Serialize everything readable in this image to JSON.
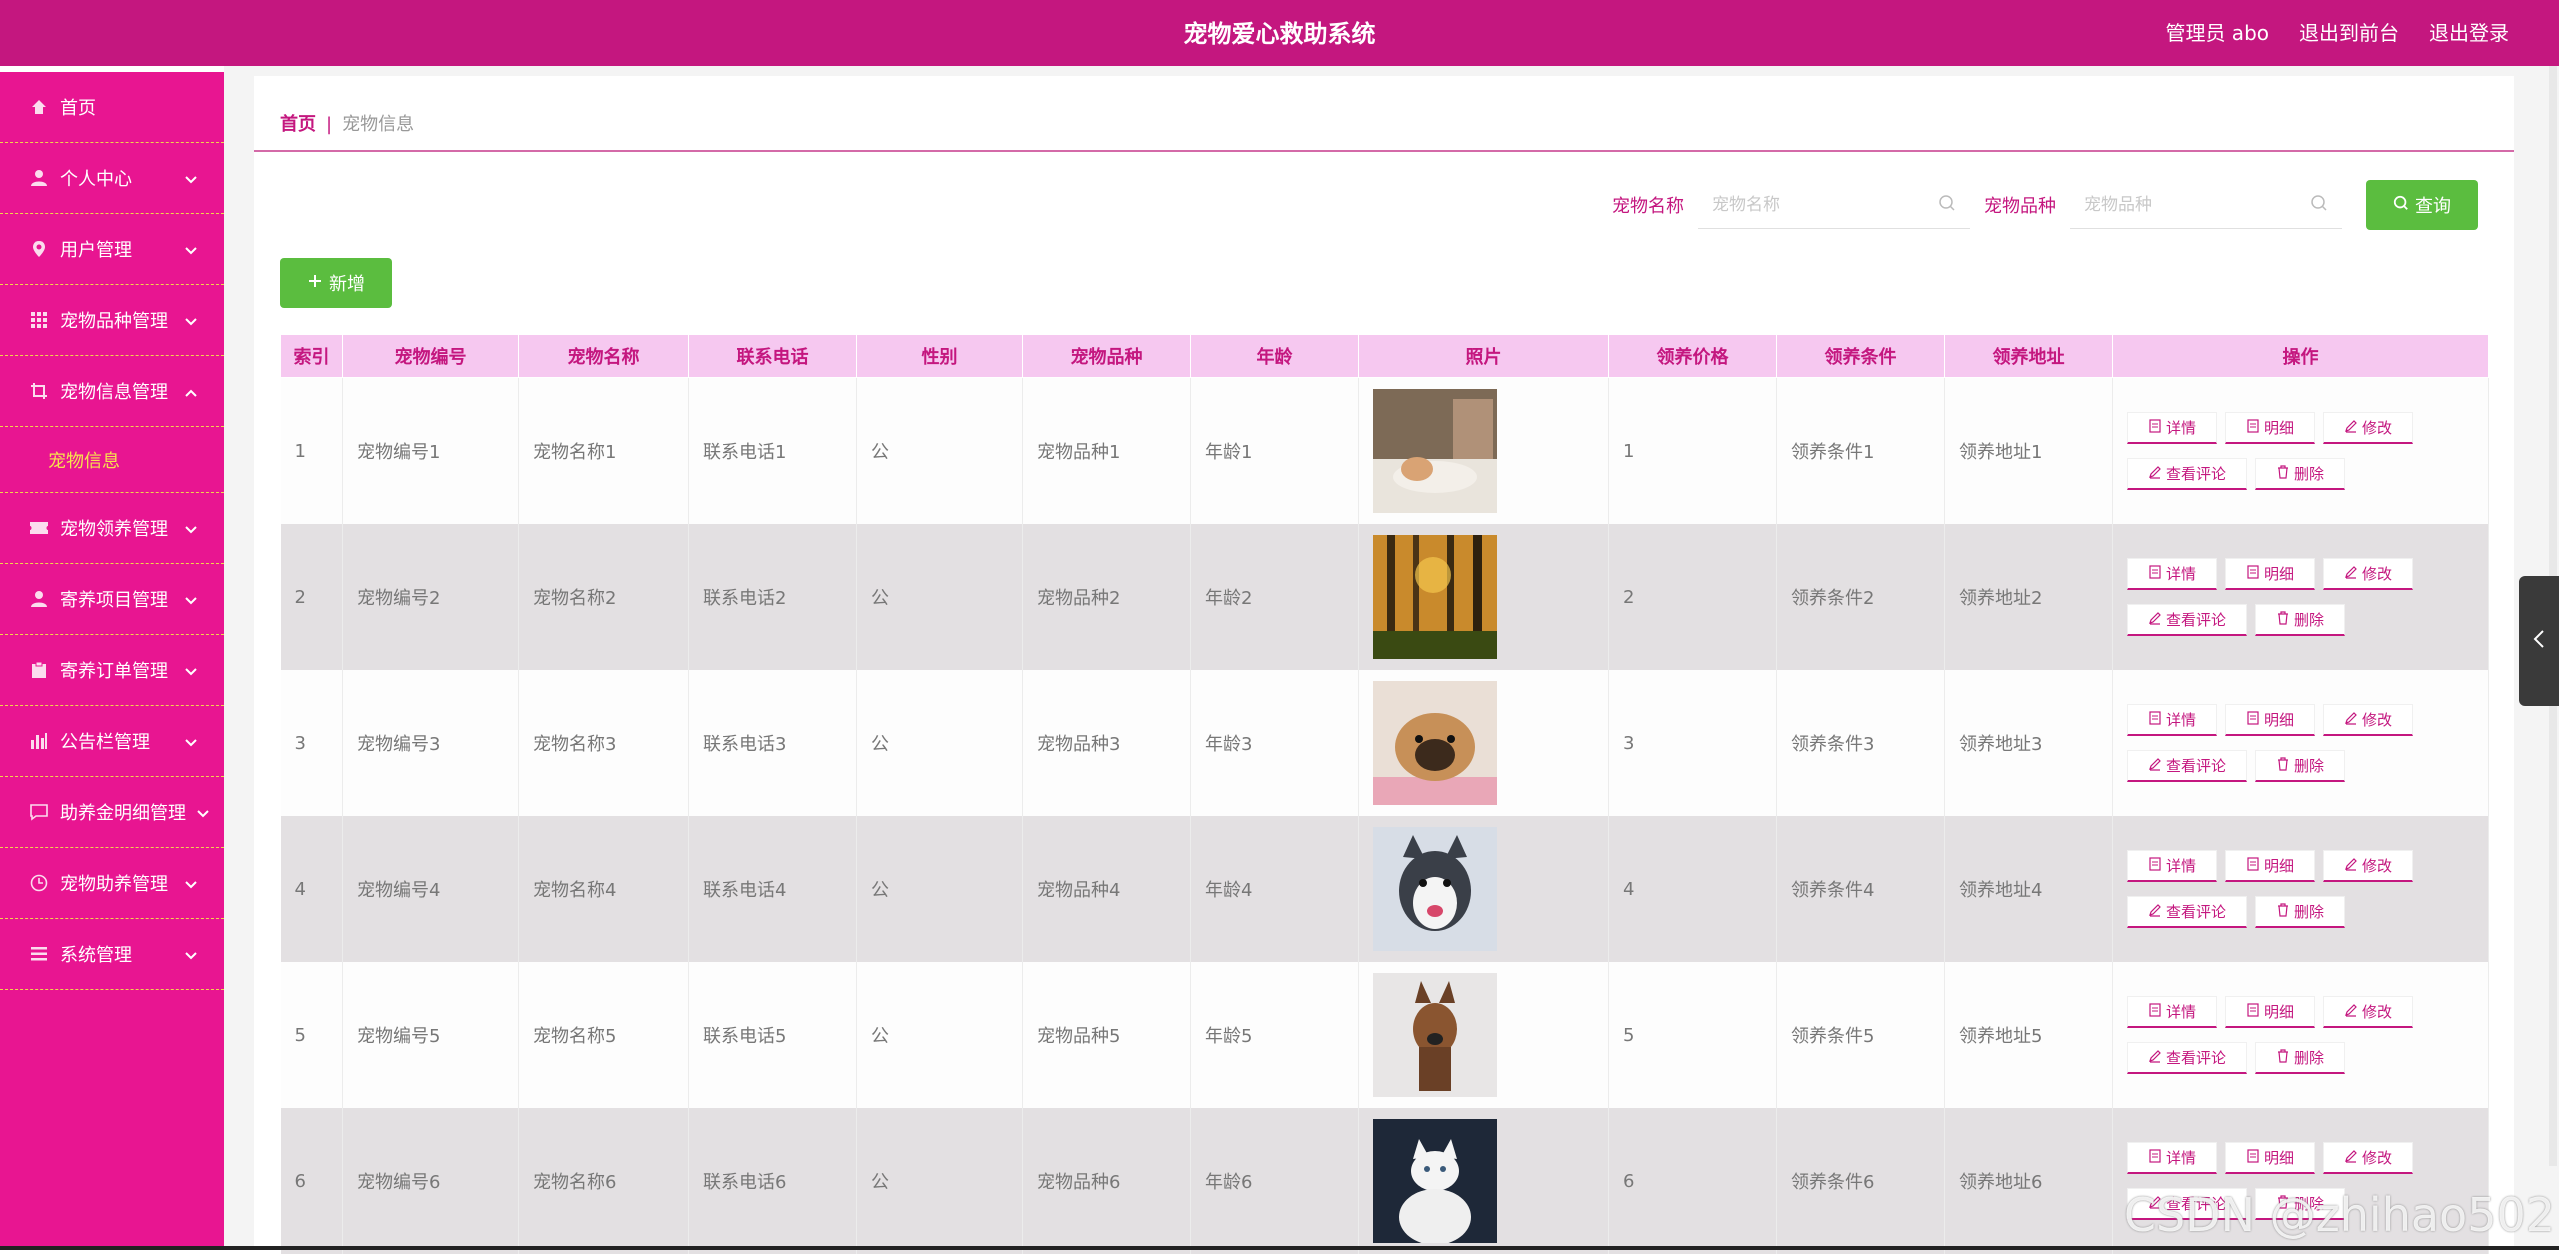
{
  "header": {
    "title": "宠物爱心救助系统",
    "admin_label": "管理员 abo",
    "to_front_label": "退出到前台",
    "logout_label": "退出登录",
    "bg_color": "#c4177f"
  },
  "sidebar": {
    "bg_color": "#e81591",
    "items": [
      {
        "label": "首页",
        "icon": "home-icon"
      },
      {
        "label": "个人中心",
        "icon": "user-icon"
      },
      {
        "label": "用户管理",
        "icon": "location-icon"
      },
      {
        "label": "宠物品种管理",
        "icon": "grid-icon"
      },
      {
        "label": "宠物信息管理",
        "icon": "crop-icon",
        "expanded": true,
        "sub": "宠物信息"
      },
      {
        "label": "宠物领养管理",
        "icon": "ticket-icon"
      },
      {
        "label": "寄养项目管理",
        "icon": "user-icon"
      },
      {
        "label": "寄养订单管理",
        "icon": "clipboard-icon"
      },
      {
        "label": "公告栏管理",
        "icon": "bar-chart-icon"
      },
      {
        "label": "助养金明细管理",
        "icon": "message-icon"
      },
      {
        "label": "宠物助养管理",
        "icon": "clock-icon"
      },
      {
        "label": "系统管理",
        "icon": "list-icon"
      }
    ]
  },
  "breadcrumb": {
    "home": "首页",
    "separator": "|",
    "current": "宠物信息"
  },
  "search": {
    "name_label": "宠物名称",
    "name_placeholder": "宠物名称",
    "breed_label": "宠物品种",
    "breed_placeholder": "宠物品种",
    "query_label": "查询"
  },
  "add_label": "新增",
  "table": {
    "columns": [
      "索引",
      "宠物编号",
      "宠物名称",
      "联系电话",
      "性别",
      "宠物品种",
      "年龄",
      "照片",
      "领养价格",
      "领养条件",
      "领养地址",
      "操作"
    ],
    "rows": [
      {
        "index": "1",
        "code": "宠物编号1",
        "name": "宠物名称1",
        "phone": "联系电话1",
        "gender": "公",
        "breed": "宠物品种1",
        "age": "年龄1",
        "photo": "cat",
        "price": "1",
        "condition": "领养条件1",
        "address": "领养地址1"
      },
      {
        "index": "2",
        "code": "宠物编号2",
        "name": "宠物名称2",
        "phone": "联系电话2",
        "gender": "公",
        "breed": "宠物品种2",
        "age": "年龄2",
        "photo": "forest",
        "price": "2",
        "condition": "领养条件2",
        "address": "领养地址2"
      },
      {
        "index": "3",
        "code": "宠物编号3",
        "name": "宠物名称3",
        "phone": "联系电话3",
        "gender": "公",
        "breed": "宠物品种3",
        "age": "年龄3",
        "photo": "pug",
        "price": "3",
        "condition": "领养条件3",
        "address": "领养地址3"
      },
      {
        "index": "4",
        "code": "宠物编号4",
        "name": "宠物名称4",
        "phone": "联系电话4",
        "gender": "公",
        "breed": "宠物品种4",
        "age": "年龄4",
        "photo": "husky",
        "price": "4",
        "condition": "领养条件4",
        "address": "领养地址4"
      },
      {
        "index": "5",
        "code": "宠物编号5",
        "name": "宠物名称5",
        "phone": "联系电话5",
        "gender": "公",
        "breed": "宠物品种5",
        "age": "年龄5",
        "photo": "shepherd",
        "price": "5",
        "condition": "领养条件5",
        "address": "领养地址5"
      },
      {
        "index": "6",
        "code": "宠物编号6",
        "name": "宠物名称6",
        "phone": "联系电话6",
        "gender": "公",
        "breed": "宠物品种6",
        "age": "年龄6",
        "photo": "white-cat",
        "price": "6",
        "condition": "领养条件6",
        "address": "领养地址6"
      }
    ],
    "actions": {
      "detail": "详情",
      "breakdown": "明细",
      "edit": "修改",
      "comments": "查看评论",
      "delete": "删除"
    }
  },
  "watermark": "CSDN @zhihao502",
  "colors": {
    "accent": "#c4177f",
    "green": "#5bbd3f",
    "header_row": "#f6c8f0",
    "submenu_text": "#f6e24e"
  }
}
